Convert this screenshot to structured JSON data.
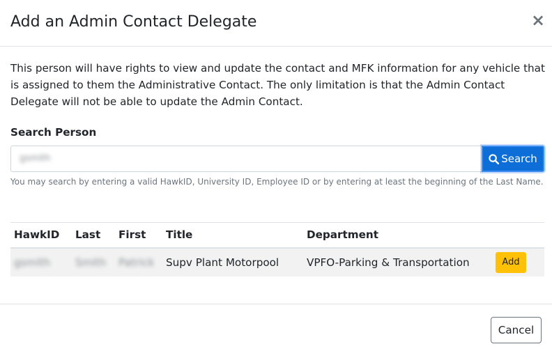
{
  "modal": {
    "title": "Add an Admin Contact Delegate",
    "close_label": "×",
    "description": "This person will have rights to view and update the contact and MFK information for any vehicle that is assigned to them the Administrative Contact. The only limitation is that the Admin Contact Delegate will not be able to update the Admin Contact."
  },
  "search": {
    "label": "Search Person",
    "value": "gsmith",
    "button_label": "Search",
    "help": "You may search by entering a valid HawkID, University ID, Employee ID or by entering at least the beginning of the Last Name."
  },
  "table": {
    "columns": [
      "HawkID",
      "Last",
      "First",
      "Title",
      "Department"
    ],
    "rows": [
      {
        "hawkid": "gsmith",
        "last": "Smith",
        "first": "Patrick",
        "title": "Supv Plant Motorpool",
        "department": "VPFO-Parking & Transportation",
        "action_label": "Add"
      }
    ]
  },
  "footer": {
    "cancel_label": "Cancel"
  },
  "colors": {
    "primary": "#0d6ed8",
    "warning": "#ffc107",
    "border": "#dee2e6",
    "muted": "#6c757d"
  }
}
